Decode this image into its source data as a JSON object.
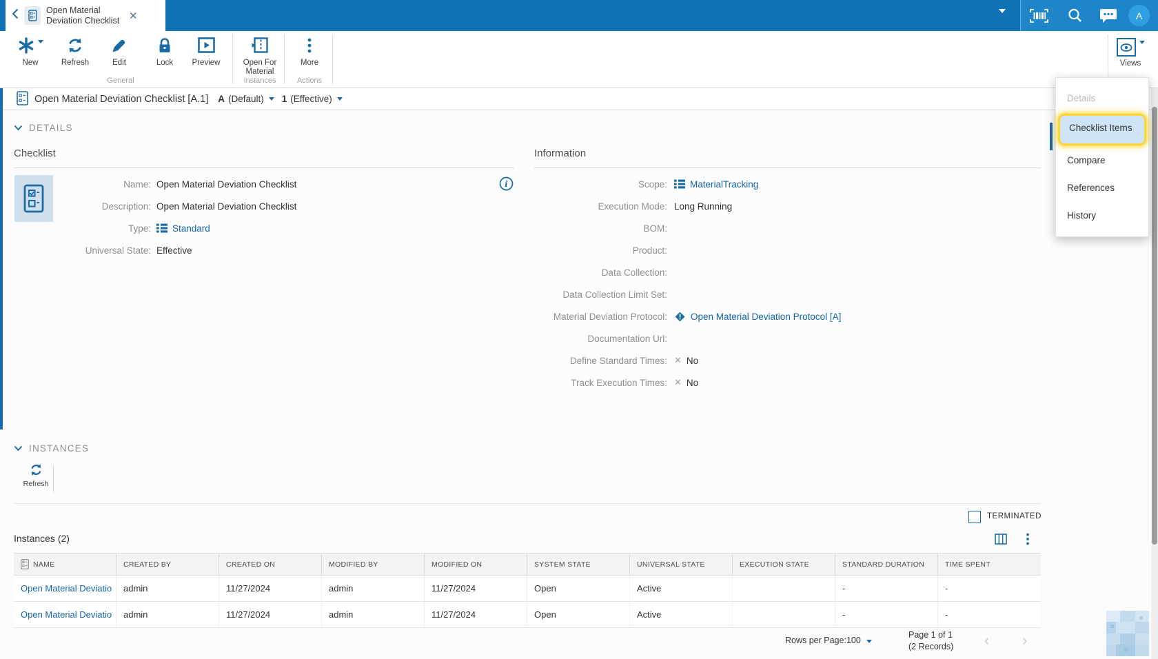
{
  "topbar": {
    "tab_title": "Open Material Deviation Checklist",
    "avatar": "A"
  },
  "toolbar": {
    "buttons": [
      {
        "label": "New"
      },
      {
        "label": "Refresh"
      },
      {
        "label": "Edit"
      },
      {
        "label": "Lock"
      },
      {
        "label": "Preview"
      },
      {
        "label": "Open For Material"
      },
      {
        "label": "More"
      }
    ],
    "groups": [
      {
        "label": "General"
      },
      {
        "label": "Instances"
      },
      {
        "label": "Actions"
      }
    ],
    "views_label": "Views"
  },
  "views_menu": {
    "items": [
      {
        "label": "Details",
        "disabled": true
      },
      {
        "label": "Checklist Items",
        "selected": true
      },
      {
        "label": "Compare"
      },
      {
        "label": "References"
      },
      {
        "label": "History"
      }
    ]
  },
  "breadcrumb": {
    "title": "Open Material Deviation Checklist [A.1]",
    "revision": "A",
    "revision_note": "(Default)",
    "version": "1",
    "version_note": "(Effective)"
  },
  "details": {
    "section_label": "DETAILS",
    "checklist_panel": {
      "title": "Checklist",
      "fields": [
        {
          "label": "Name:",
          "value": "Open Material Deviation Checklist"
        },
        {
          "label": "Description:",
          "value": "Open Material Deviation Checklist"
        },
        {
          "label": "Type:",
          "value": "Standard"
        },
        {
          "label": "Universal State:",
          "value": "Effective"
        }
      ]
    },
    "information_panel": {
      "title": "Information",
      "fields": [
        {
          "label": "Scope:",
          "value": "MaterialTracking"
        },
        {
          "label": "Execution Mode:",
          "value": "Long Running"
        },
        {
          "label": "BOM:",
          "value": ""
        },
        {
          "label": "Product:",
          "value": ""
        },
        {
          "label": "Data Collection:",
          "value": ""
        },
        {
          "label": "Data Collection Limit Set:",
          "value": ""
        },
        {
          "label": "Material Deviation Protocol:",
          "value": "Open Material Deviation Protocol [A]"
        },
        {
          "label": "Documentation Url:",
          "value": ""
        },
        {
          "label": "Define Standard Times:",
          "value": "No"
        },
        {
          "label": "Track Execution Times:",
          "value": "No"
        }
      ]
    }
  },
  "instances": {
    "section_label": "INSTANCES",
    "refresh_label": "Refresh",
    "terminated_label": "TERMINATED",
    "table_title": "Instances (2)",
    "columns": [
      "NAME",
      "CREATED BY",
      "CREATED ON",
      "MODIFIED BY",
      "MODIFIED ON",
      "SYSTEM STATE",
      "UNIVERSAL STATE",
      "EXECUTION STATE",
      "STANDARD DURATION",
      "TIME SPENT"
    ],
    "rows": [
      [
        "Open Material Deviatio",
        "admin",
        "11/27/2024",
        "admin",
        "11/27/2024",
        "Open",
        "Active",
        "",
        "-",
        "-"
      ],
      [
        "Open Material Deviatio",
        "admin",
        "11/27/2024",
        "admin",
        "11/27/2024",
        "Open",
        "Active",
        "",
        "-",
        "-"
      ]
    ],
    "footer": {
      "rows_per_page_label": "Rows per Page:",
      "rows_per_page_value": "100",
      "page_info": "Page 1 of 1",
      "records_info": "(2 Records)"
    }
  },
  "colors": {
    "topbar": "#1173b5",
    "topbar_light": "#1e86c8",
    "accent": "#1b6ca6",
    "link": "#1565a8",
    "highlight_border": "#ffd43b",
    "highlight_bg": "#cfe4f7",
    "table_header_bg": "#f3f3f4"
  }
}
